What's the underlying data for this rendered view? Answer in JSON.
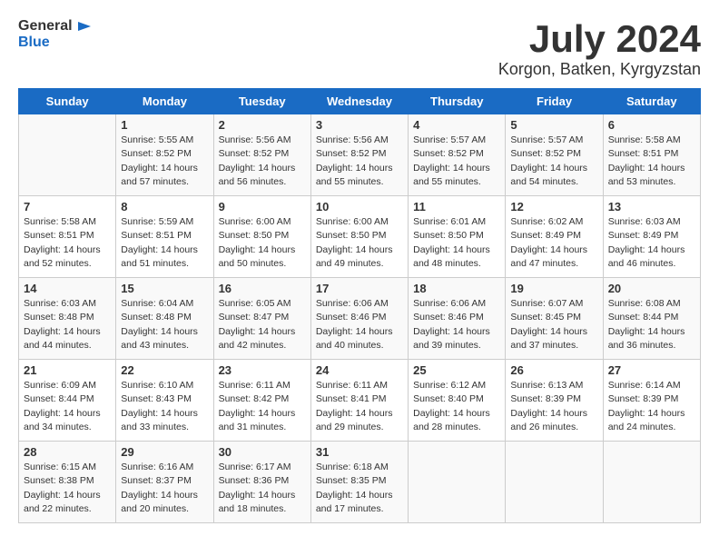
{
  "header": {
    "logo_general": "General",
    "logo_blue": "Blue",
    "month_title": "July 2024",
    "location": "Korgon, Batken, Kyrgyzstan"
  },
  "days_of_week": [
    "Sunday",
    "Monday",
    "Tuesday",
    "Wednesday",
    "Thursday",
    "Friday",
    "Saturday"
  ],
  "weeks": [
    [
      {
        "day": "",
        "content": ""
      },
      {
        "day": "1",
        "content": "Sunrise: 5:55 AM\nSunset: 8:52 PM\nDaylight: 14 hours\nand 57 minutes."
      },
      {
        "day": "2",
        "content": "Sunrise: 5:56 AM\nSunset: 8:52 PM\nDaylight: 14 hours\nand 56 minutes."
      },
      {
        "day": "3",
        "content": "Sunrise: 5:56 AM\nSunset: 8:52 PM\nDaylight: 14 hours\nand 55 minutes."
      },
      {
        "day": "4",
        "content": "Sunrise: 5:57 AM\nSunset: 8:52 PM\nDaylight: 14 hours\nand 55 minutes."
      },
      {
        "day": "5",
        "content": "Sunrise: 5:57 AM\nSunset: 8:52 PM\nDaylight: 14 hours\nand 54 minutes."
      },
      {
        "day": "6",
        "content": "Sunrise: 5:58 AM\nSunset: 8:51 PM\nDaylight: 14 hours\nand 53 minutes."
      }
    ],
    [
      {
        "day": "7",
        "content": "Sunrise: 5:58 AM\nSunset: 8:51 PM\nDaylight: 14 hours\nand 52 minutes."
      },
      {
        "day": "8",
        "content": "Sunrise: 5:59 AM\nSunset: 8:51 PM\nDaylight: 14 hours\nand 51 minutes."
      },
      {
        "day": "9",
        "content": "Sunrise: 6:00 AM\nSunset: 8:50 PM\nDaylight: 14 hours\nand 50 minutes."
      },
      {
        "day": "10",
        "content": "Sunrise: 6:00 AM\nSunset: 8:50 PM\nDaylight: 14 hours\nand 49 minutes."
      },
      {
        "day": "11",
        "content": "Sunrise: 6:01 AM\nSunset: 8:50 PM\nDaylight: 14 hours\nand 48 minutes."
      },
      {
        "day": "12",
        "content": "Sunrise: 6:02 AM\nSunset: 8:49 PM\nDaylight: 14 hours\nand 47 minutes."
      },
      {
        "day": "13",
        "content": "Sunrise: 6:03 AM\nSunset: 8:49 PM\nDaylight: 14 hours\nand 46 minutes."
      }
    ],
    [
      {
        "day": "14",
        "content": "Sunrise: 6:03 AM\nSunset: 8:48 PM\nDaylight: 14 hours\nand 44 minutes."
      },
      {
        "day": "15",
        "content": "Sunrise: 6:04 AM\nSunset: 8:48 PM\nDaylight: 14 hours\nand 43 minutes."
      },
      {
        "day": "16",
        "content": "Sunrise: 6:05 AM\nSunset: 8:47 PM\nDaylight: 14 hours\nand 42 minutes."
      },
      {
        "day": "17",
        "content": "Sunrise: 6:06 AM\nSunset: 8:46 PM\nDaylight: 14 hours\nand 40 minutes."
      },
      {
        "day": "18",
        "content": "Sunrise: 6:06 AM\nSunset: 8:46 PM\nDaylight: 14 hours\nand 39 minutes."
      },
      {
        "day": "19",
        "content": "Sunrise: 6:07 AM\nSunset: 8:45 PM\nDaylight: 14 hours\nand 37 minutes."
      },
      {
        "day": "20",
        "content": "Sunrise: 6:08 AM\nSunset: 8:44 PM\nDaylight: 14 hours\nand 36 minutes."
      }
    ],
    [
      {
        "day": "21",
        "content": "Sunrise: 6:09 AM\nSunset: 8:44 PM\nDaylight: 14 hours\nand 34 minutes."
      },
      {
        "day": "22",
        "content": "Sunrise: 6:10 AM\nSunset: 8:43 PM\nDaylight: 14 hours\nand 33 minutes."
      },
      {
        "day": "23",
        "content": "Sunrise: 6:11 AM\nSunset: 8:42 PM\nDaylight: 14 hours\nand 31 minutes."
      },
      {
        "day": "24",
        "content": "Sunrise: 6:11 AM\nSunset: 8:41 PM\nDaylight: 14 hours\nand 29 minutes."
      },
      {
        "day": "25",
        "content": "Sunrise: 6:12 AM\nSunset: 8:40 PM\nDaylight: 14 hours\nand 28 minutes."
      },
      {
        "day": "26",
        "content": "Sunrise: 6:13 AM\nSunset: 8:39 PM\nDaylight: 14 hours\nand 26 minutes."
      },
      {
        "day": "27",
        "content": "Sunrise: 6:14 AM\nSunset: 8:39 PM\nDaylight: 14 hours\nand 24 minutes."
      }
    ],
    [
      {
        "day": "28",
        "content": "Sunrise: 6:15 AM\nSunset: 8:38 PM\nDaylight: 14 hours\nand 22 minutes."
      },
      {
        "day": "29",
        "content": "Sunrise: 6:16 AM\nSunset: 8:37 PM\nDaylight: 14 hours\nand 20 minutes."
      },
      {
        "day": "30",
        "content": "Sunrise: 6:17 AM\nSunset: 8:36 PM\nDaylight: 14 hours\nand 18 minutes."
      },
      {
        "day": "31",
        "content": "Sunrise: 6:18 AM\nSunset: 8:35 PM\nDaylight: 14 hours\nand 17 minutes."
      },
      {
        "day": "",
        "content": ""
      },
      {
        "day": "",
        "content": ""
      },
      {
        "day": "",
        "content": ""
      }
    ]
  ]
}
